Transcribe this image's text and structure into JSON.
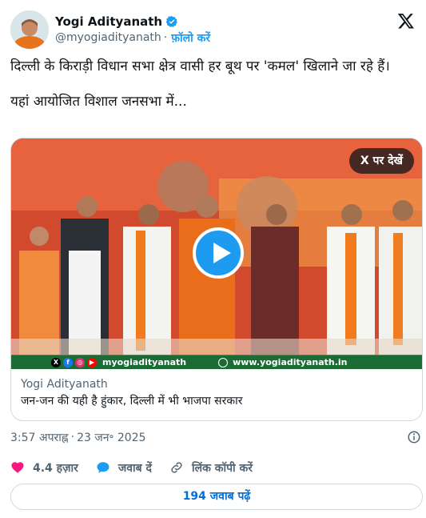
{
  "author": {
    "display_name": "Yogi Adityanath",
    "handle": "@myogiadityanath",
    "separator": "·",
    "follow_label": "फ़ॉलो करें",
    "verified_icon": "verified-badge-icon"
  },
  "tweet": {
    "line1": "दिल्ली के किराड़ी विधान सभा क्षेत्र वासी हर बूथ पर 'कमल' खिलाने जा रहे हैं।",
    "line2": "यहां आयोजित विशाल जनसभा में..."
  },
  "media": {
    "watch_on_x": "X पर देखें",
    "strip_handle": "myogiadityanath",
    "strip_site": "www.yogiadityanath.in",
    "card_domain": "Yogi Adityanath",
    "card_title": "जन-जन की यही है हुंकार, दिल्ली में भी भाजपा सरकार"
  },
  "timestamp": {
    "time": "3:57 अपराह्न",
    "separator": "·",
    "date": "23 जन॰ 2025"
  },
  "actions": {
    "likes": "4.4 हज़ार",
    "reply": "जवाब दें",
    "copy_link": "लिंक कॉपी करें"
  },
  "read_replies": "194 जवाब पढ़ें",
  "colors": {
    "accent": "#1d9bf0",
    "like": "#f91880",
    "link_button": "#006fd6"
  }
}
